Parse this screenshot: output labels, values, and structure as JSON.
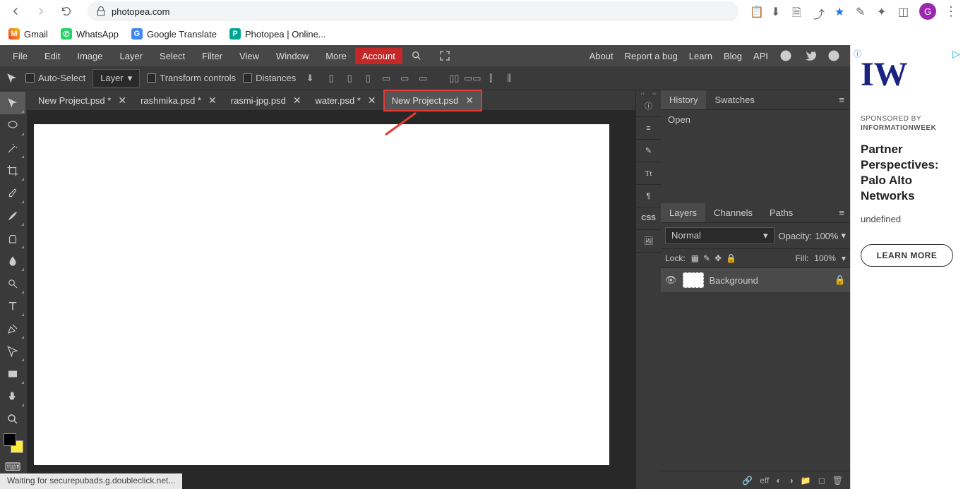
{
  "browser": {
    "url": "photopea.com",
    "profile_initial": "G",
    "bookmarks": [
      {
        "label": "Gmail",
        "icon": "gmail"
      },
      {
        "label": "WhatsApp",
        "icon": "whatsapp"
      },
      {
        "label": "Google Translate",
        "icon": "translate"
      },
      {
        "label": "Photopea | Online...",
        "icon": "photopea"
      }
    ]
  },
  "menu": {
    "items": [
      "File",
      "Edit",
      "Image",
      "Layer",
      "Select",
      "Filter",
      "View",
      "Window",
      "More"
    ],
    "account": "Account",
    "right": [
      "About",
      "Report a bug",
      "Learn",
      "Blog",
      "API"
    ]
  },
  "options": {
    "auto_select": "Auto-Select",
    "target": "Layer",
    "transform": "Transform controls",
    "distances": "Distances"
  },
  "tabs": [
    {
      "label": "New Project.psd *",
      "active": false
    },
    {
      "label": "rashmika.psd *",
      "active": false
    },
    {
      "label": "rasmi-jpg.psd",
      "active": false
    },
    {
      "label": "water.psd *",
      "active": false
    },
    {
      "label": "New Project.psd",
      "active": true
    }
  ],
  "history_panel": {
    "tabs": [
      "History",
      "Swatches"
    ],
    "active_tab": "History",
    "items": [
      "Open"
    ]
  },
  "layers_panel": {
    "tabs": [
      "Layers",
      "Channels",
      "Paths"
    ],
    "active_tab": "Layers",
    "blend_mode": "Normal",
    "opacity_label": "Opacity:",
    "opacity_value": "100%",
    "lock_label": "Lock:",
    "fill_label": "Fill:",
    "fill_value": "100%",
    "layers": [
      {
        "name": "Background",
        "locked": true
      }
    ]
  },
  "right_strip": [
    "<>",
    "ℹ",
    "≡",
    "✎",
    "Tt",
    "¶",
    "CSS",
    "🖼"
  ],
  "ad": {
    "logo": "IW",
    "sponsor_label": "SPONSORED BY",
    "brand": "INFORMATIONWEEK",
    "headline": "Partner Perspectives: Palo Alto Networks",
    "description": "undefined",
    "cta": "LEARN MORE"
  },
  "status": "Waiting for securepubads.g.doubleclick.net..."
}
